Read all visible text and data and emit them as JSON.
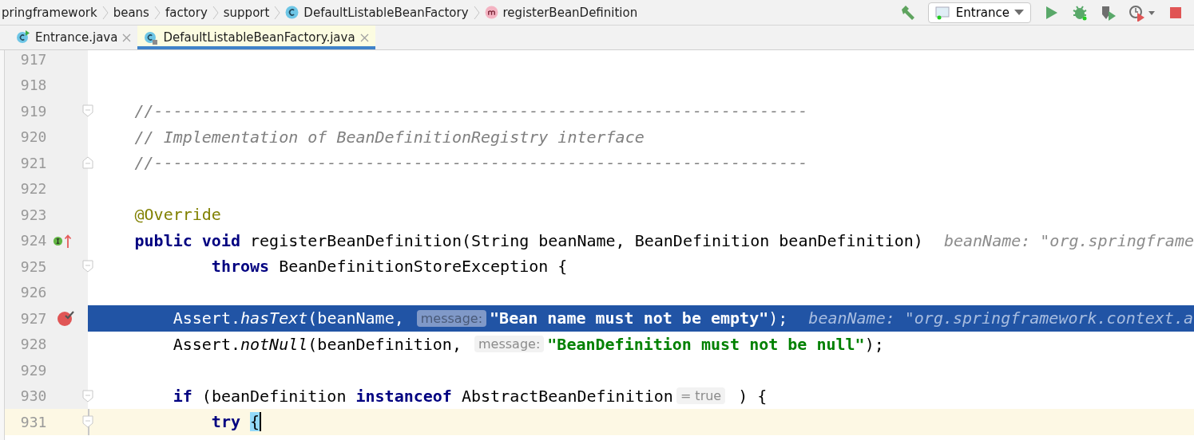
{
  "breadcrumbs": [
    {
      "text": "pringframework",
      "kind": "package"
    },
    {
      "text": "beans",
      "kind": "package"
    },
    {
      "text": "factory",
      "kind": "package"
    },
    {
      "text": "support",
      "kind": "package"
    },
    {
      "text": "DefaultListableBeanFactory",
      "kind": "class"
    },
    {
      "text": "registerBeanDefinition",
      "kind": "method"
    }
  ],
  "run_config": {
    "label": "Entrance"
  },
  "tabs": [
    {
      "label": "Entrance.java",
      "selected": false,
      "kind": "runnable-class"
    },
    {
      "label": "DefaultListableBeanFactory.java",
      "selected": true,
      "kind": "locked-class"
    }
  ],
  "lines": [
    {
      "number": "917"
    },
    {
      "number": "918"
    },
    {
      "number": "919",
      "fold_start": true,
      "parts": [
        {
          "kind": "code",
          "tokens": [
            {
              "kind": "comment",
              "text": "    //--------------------------------------------------------------------"
            }
          ]
        }
      ]
    },
    {
      "number": "920",
      "parts": [
        {
          "kind": "code",
          "tokens": [
            {
              "kind": "comment",
              "text": "    // Implementation of BeanDefinitionRegistry interface"
            }
          ]
        }
      ]
    },
    {
      "number": "921",
      "fold_end": true,
      "parts": [
        {
          "kind": "code",
          "tokens": [
            {
              "kind": "comment",
              "text": "    //--------------------------------------------------------------------"
            }
          ]
        }
      ]
    },
    {
      "number": "922"
    },
    {
      "number": "923",
      "parts": [
        {
          "kind": "code",
          "tokens": [
            {
              "kind": "annotation",
              "text": "    @Override"
            }
          ]
        }
      ]
    },
    {
      "number": "924",
      "implements_marker": true,
      "overrides_marker": true,
      "parts": [
        {
          "kind": "code",
          "tokens": [
            {
              "kind": "keyword",
              "text": "    public void"
            },
            {
              "kind": "plain",
              "text": " registerBeanDefinition(String beanName, BeanDefinition beanDefinition)"
            }
          ]
        },
        {
          "kind": "debug-value",
          "text": "beanName: \"org.springframe"
        }
      ]
    },
    {
      "number": "925",
      "fold_start": true,
      "parts": [
        {
          "kind": "code",
          "tokens": [
            {
              "kind": "keyword",
              "text": "            throws"
            },
            {
              "kind": "plain",
              "text": " BeanDefinitionStoreException {"
            }
          ]
        }
      ]
    },
    {
      "number": "926"
    },
    {
      "number": "927",
      "selected": true,
      "breakpoint": true,
      "parts": [
        {
          "kind": "code",
          "tokens": [
            {
              "kind": "plain",
              "text": "        Assert."
            },
            {
              "kind": "method",
              "text": "hasText"
            },
            {
              "kind": "plain",
              "text": "(beanName, "
            }
          ]
        },
        {
          "kind": "hint",
          "text": "message:"
        },
        {
          "kind": "code",
          "tokens": [
            {
              "kind": "string",
              "text": "\"Bean name must not be empty\""
            },
            {
              "kind": "plain",
              "text": ");"
            }
          ]
        },
        {
          "kind": "debug-value",
          "text": "beanName: \"org.springframework.context.a"
        }
      ]
    },
    {
      "number": "928",
      "parts": [
        {
          "kind": "code",
          "tokens": [
            {
              "kind": "plain",
              "text": "        Assert."
            },
            {
              "kind": "method",
              "text": "notNull"
            },
            {
              "kind": "plain",
              "text": "(beanDefinition, "
            }
          ]
        },
        {
          "kind": "hint",
          "text": "message:"
        },
        {
          "kind": "code",
          "tokens": [
            {
              "kind": "string",
              "text": "\"BeanDefinition must not be null\""
            },
            {
              "kind": "plain",
              "text": ");"
            }
          ]
        }
      ]
    },
    {
      "number": "929"
    },
    {
      "number": "930",
      "fold_start": true,
      "parts": [
        {
          "kind": "code",
          "tokens": [
            {
              "kind": "keyword",
              "text": "        if"
            },
            {
              "kind": "plain",
              "text": " (beanDefinition "
            },
            {
              "kind": "keyword",
              "text": "instanceof"
            },
            {
              "kind": "plain",
              "text": " AbstractBeanDefinition"
            }
          ]
        },
        {
          "kind": "hint",
          "text": "= true"
        },
        {
          "kind": "code",
          "tokens": [
            {
              "kind": "plain",
              "text": " ) {"
            }
          ]
        }
      ]
    },
    {
      "number": "931",
      "current": true,
      "fold_start": true,
      "parts": [
        {
          "kind": "code",
          "tokens": [
            {
              "kind": "keyword",
              "text": "            try "
            },
            {
              "kind": "brace-match",
              "text": "{"
            }
          ]
        }
      ]
    }
  ]
}
